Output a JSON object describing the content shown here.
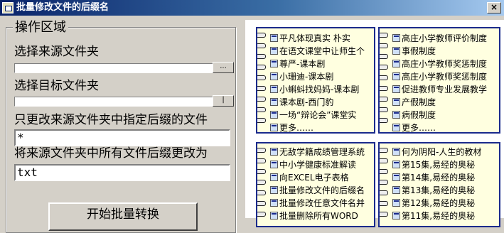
{
  "window": {
    "title": "批量修改文件的后缀名",
    "close_glyph": "×"
  },
  "operations": {
    "group_title": "操作区域",
    "source_label": "选择来源文件夹",
    "source_browse": "...",
    "target_label": "选择目标文件夹",
    "target_browse": "|",
    "filter_label": "只更改来源文件夹中指定后缀的文件",
    "filter_value": "*",
    "newext_label": "将来源文件夹中所有文件后缀更改为",
    "newext_value": "txt",
    "start_button": "开始批量转换"
  },
  "notepads": {
    "top_left": [
      "平凡体现真实 朴实",
      "在语文课堂中让师生个",
      "尊严-课本剧",
      "小珊迪-课本剧",
      "小蝌蚪找妈妈-课本剧",
      "课本剧-西门豹",
      "一场“辩论会”课堂实",
      "更多……"
    ],
    "top_right": [
      "高庄小学教师评价制度",
      "事假制度",
      "高庄小学教师奖惩制度",
      "高庄小学教师奖惩制度",
      "促进教师专业发展教学",
      "产假制度",
      "病假制度",
      "更多……"
    ],
    "bottom_left": [
      "无敌学籍成绩管理系统",
      "中小学健康标准解读",
      "向EXCEL电子表格",
      "批量修改文件的后缀名",
      "批量修改任意文件名并",
      "批量删除所有WORD"
    ],
    "bottom_right": [
      "何为阴阳-人生的教材",
      "第15集,易经的奥秘",
      "第14集,易经的奥秘",
      "第13集,易经的奥秘",
      "第12集,易经的奥秘",
      "第11集,易经的奥秘"
    ]
  }
}
